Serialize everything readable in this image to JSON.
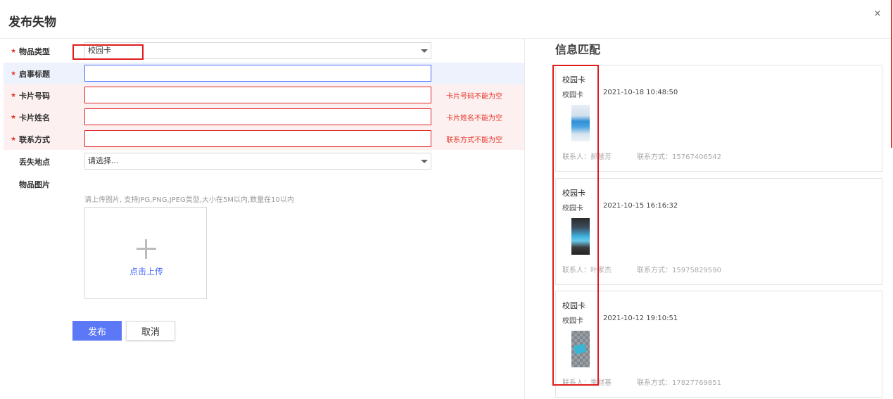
{
  "dialog": {
    "title": "发布失物",
    "close": "×"
  },
  "form": {
    "type": {
      "label": "物品类型",
      "value": "校园卡"
    },
    "title": {
      "label": "启事标题",
      "value": ""
    },
    "card_no": {
      "label": "卡片号码",
      "value": "",
      "error": "卡片号码不能为空"
    },
    "card_name": {
      "label": "卡片姓名",
      "value": "",
      "error": "卡片姓名不能为空"
    },
    "contact": {
      "label": "联系方式",
      "value": "",
      "error": "联系方式不能为空"
    },
    "location": {
      "label": "丢失地点",
      "placeholder": "请选择..."
    },
    "photo": {
      "label": "物品图片",
      "hint": "请上传图片, 支持JPG,PNG,JPEG类型,大小在5M以内,数量在10以内",
      "upload_label": "点击上传"
    },
    "submit_label": "发布",
    "cancel_label": "取消"
  },
  "match": {
    "title": "信息匹配",
    "cards": [
      {
        "name": "校园卡",
        "type": "校园卡",
        "time": "2021-10-18 10:48:50",
        "contact": "联系人：郝慧芳",
        "phone": "联系方式：15767406542"
      },
      {
        "name": "校园卡",
        "type": "校园卡",
        "time": "2021-10-15 16:16:32",
        "contact": "联系人：叶家杰",
        "phone": "联系方式：15975829590"
      },
      {
        "name": "校园卡",
        "type": "校园卡",
        "time": "2021-10-12 19:10:51",
        "contact": "联系人：季财基",
        "phone": "联系方式：17827769851"
      }
    ]
  },
  "colors": {
    "primary": "#5b78f6",
    "error": "#e6392c",
    "highlight": "#e11c1c"
  }
}
